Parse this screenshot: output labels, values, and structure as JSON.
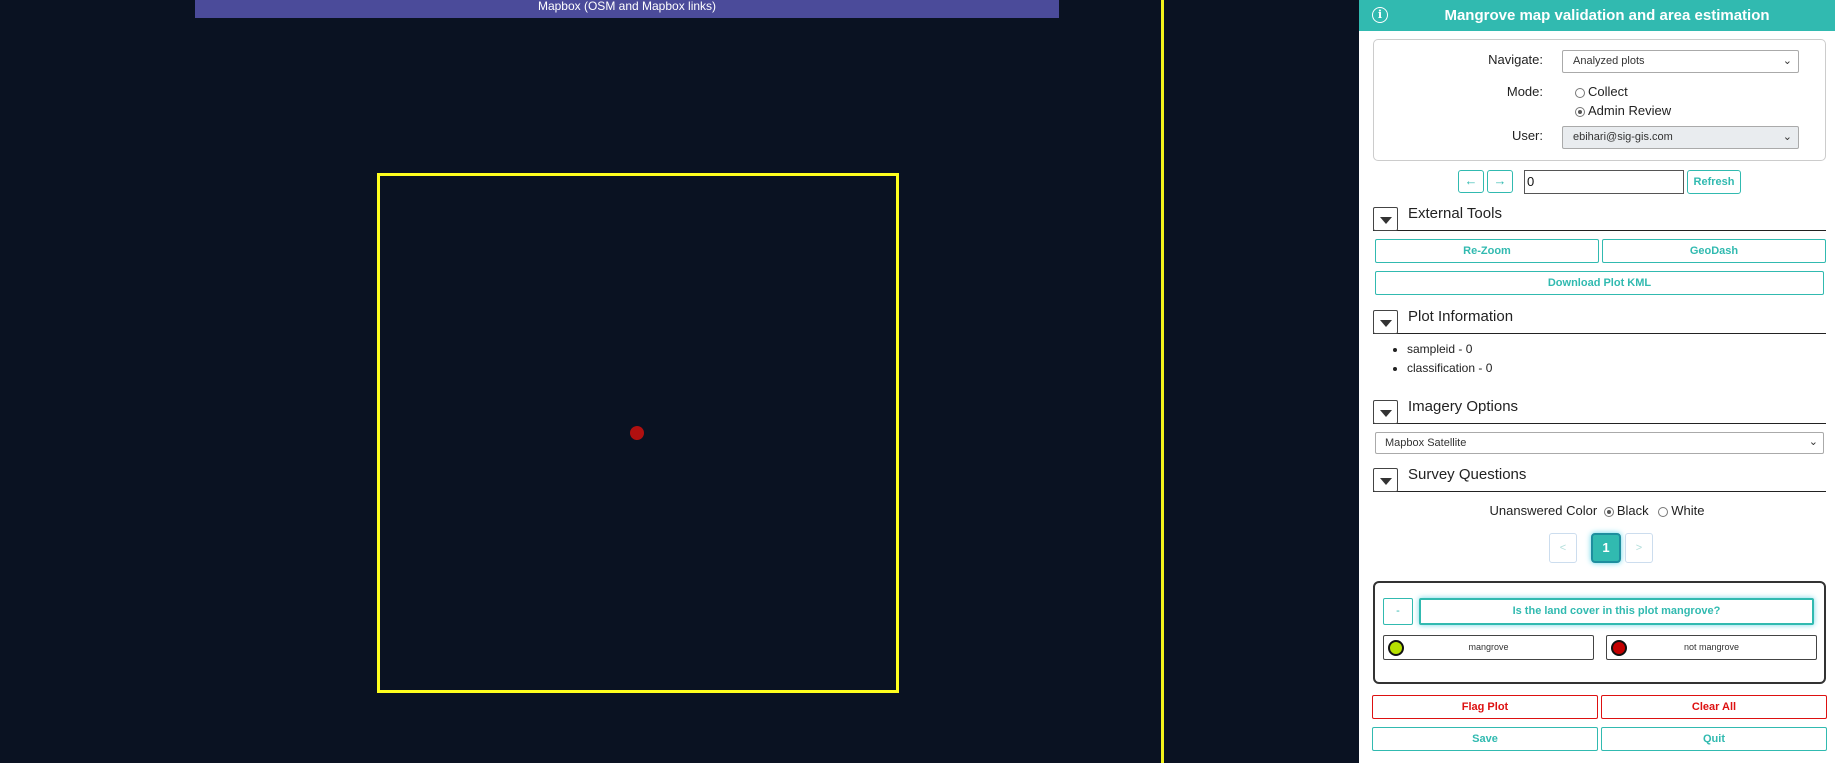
{
  "map": {
    "attribution": "Mapbox (OSM and Mapbox links)"
  },
  "sidebar": {
    "title": "Mangrove map validation and area estimation",
    "info_icon": "info-icon",
    "navigate": {
      "label": "Navigate:",
      "value": "Analyzed plots"
    },
    "mode": {
      "label": "Mode:",
      "options": [
        "Collect",
        "Admin Review"
      ],
      "selected": "Admin Review"
    },
    "user": {
      "label": "User:",
      "value": "ebihari@sig-gis.com"
    },
    "prev_icon": "←",
    "next_icon": "→",
    "plot_id": "0",
    "refresh_label": "Refresh",
    "sections": {
      "external_tools": "External Tools",
      "plot_information": "Plot Information",
      "imagery_options": "Imagery Options",
      "survey_questions": "Survey Questions"
    },
    "tools": {
      "rezoom": "Re-Zoom",
      "geodash": "GeoDash",
      "download_kml": "Download Plot KML"
    },
    "plot_info": [
      "sampleid - 0",
      "classification - 0"
    ],
    "imagery": "Mapbox Satellite",
    "unanswered": {
      "label": "Unanswered Color",
      "options": [
        "Black",
        "White"
      ],
      "selected": "Black"
    },
    "pager": {
      "prev": "<",
      "current": "1",
      "next": ">"
    },
    "question": {
      "collapse": "-",
      "text": "Is the land cover in this plot mangrove?",
      "answers": [
        {
          "label": "mangrove",
          "color": "#b6e000"
        },
        {
          "label": "not mangrove",
          "color": "#c40000"
        }
      ]
    },
    "actions": {
      "flag": "Flag Plot",
      "clear": "Clear All",
      "save": "Save",
      "quit": "Quit"
    }
  },
  "colors": {
    "accent": "#31bab0",
    "danger": "#dd1111",
    "plot_border": "#ffff1e",
    "map_bg": "#0a1222"
  }
}
